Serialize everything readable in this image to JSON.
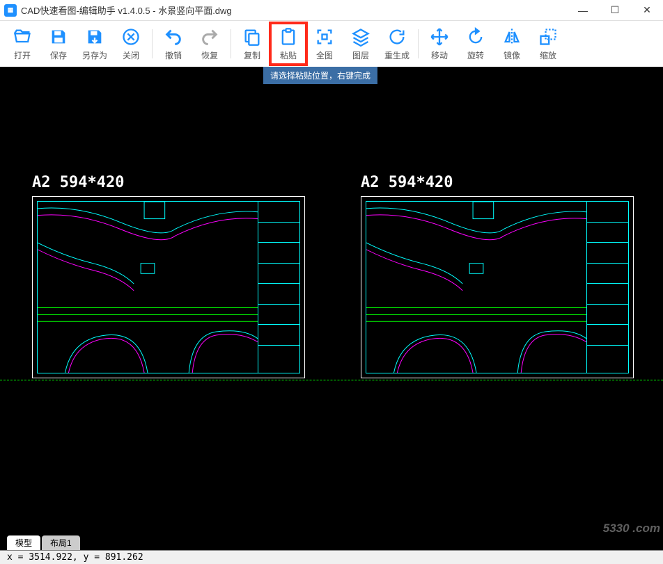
{
  "window": {
    "title": "CAD快速看图-编辑助手 v1.4.0.5 - 水景竖向平面.dwg",
    "min": "—",
    "max": "☐",
    "close": "✕"
  },
  "toolbar": {
    "open": "打开",
    "save": "保存",
    "saveas": "另存为",
    "close": "关闭",
    "undo": "撤销",
    "redo": "恢复",
    "copy": "复制",
    "paste": "粘贴",
    "zoom_extents": "全图",
    "layers": "图层",
    "regen": "重生成",
    "move": "移动",
    "rotate": "旋转",
    "mirror": "镜像",
    "scale": "缩放"
  },
  "tooltip": "请选择粘贴位置，右键完成",
  "sheet_label_left": "A2 594*420",
  "sheet_label_right": "A2 594*420",
  "tabs": {
    "model": "模型",
    "layout1": "布局1"
  },
  "status": {
    "coord": "x = 3514.922, y = 891.262"
  },
  "watermark": "5330 .com",
  "colors": {
    "accent": "#1e90ff",
    "highlight": "#ff2a1a",
    "canvas": "#000000",
    "cyan": "#00ffff",
    "green": "#00ff00",
    "magenta": "#ff00ff"
  }
}
